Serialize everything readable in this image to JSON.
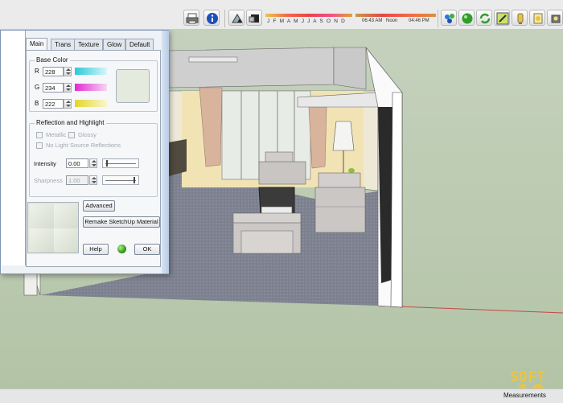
{
  "dialog": {
    "tabs": [
      "Main",
      "Trans",
      "Texture",
      "Glow",
      "Default"
    ],
    "base_color": {
      "title": "Base Color",
      "r_label": "R",
      "r_value": "228",
      "g_label": "G",
      "g_value": "234",
      "b_label": "B",
      "b_value": "222"
    },
    "reflection": {
      "title": "Reflection and Highlight",
      "metallic": "Metallic",
      "glossy": "Glossy",
      "no_light": "No Light Source Reflections"
    },
    "intensity": {
      "label": "Intensity",
      "value": "0.00"
    },
    "sharpness": {
      "label": "Sharpness",
      "value": "1.00"
    },
    "buttons": {
      "advanced": "Advanced",
      "remake": "Remake SketchUp Material",
      "help": "Help",
      "ok": "OK"
    }
  },
  "toolbar": {
    "months": "J F M A M J J A S O N D",
    "time_start": "06:43 AM",
    "time_mid": "Noon",
    "time_end": "04:46 PM"
  },
  "status": {
    "measurements_label": "Measurements"
  },
  "watermark": {
    "line1": "SOFT",
    "line2": "10"
  },
  "colors": {
    "swatch": "#e4eade",
    "ground": "#b5c7a8",
    "floor": "#7b7f8c"
  }
}
